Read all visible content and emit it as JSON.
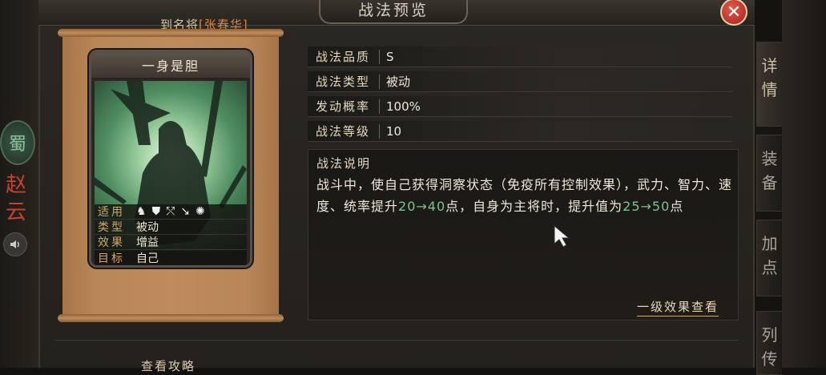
{
  "header": {
    "title": "战法预览",
    "close_icon": "close-icon"
  },
  "general": {
    "prefix": "到名将",
    "name": "[张春华]"
  },
  "left_sidebar": {
    "faction": "蜀",
    "name_chars": [
      "赵",
      "云"
    ],
    "sound_icon": "speaker-icon"
  },
  "card": {
    "title": "一身是胆",
    "rows": [
      {
        "label": "适用",
        "icons": [
          "cavalry-icon",
          "shield-icon",
          "bow-icon",
          "spear-icon",
          "wheel-icon"
        ]
      },
      {
        "label": "类型",
        "value": "被动"
      },
      {
        "label": "效果",
        "value": "增益"
      },
      {
        "label": "目标",
        "value": "自己"
      }
    ]
  },
  "info": [
    {
      "label": "战法品质",
      "value": "S"
    },
    {
      "label": "战法类型",
      "value": "被动"
    },
    {
      "label": "发动概率",
      "value": "100%"
    },
    {
      "label": "战法等级",
      "value": "10"
    }
  ],
  "description": {
    "title": "战法说明",
    "part1": "战斗中，使自己获得洞察状态（免疫所有控制效果），武力、智力、速度、统率提升",
    "range1": "20→40",
    "part2": "点，自身为主将时，提升值为",
    "range2": "25→50",
    "part3": "点"
  },
  "level_link": "一级效果查看",
  "strategy_link": "查看攻略",
  "right_tabs": [
    "详情",
    "装备",
    "加点",
    "列传"
  ],
  "colors": {
    "accent_green": "#7ec48a",
    "name_orange": "#e2843f",
    "close_red": "#c0392b"
  }
}
